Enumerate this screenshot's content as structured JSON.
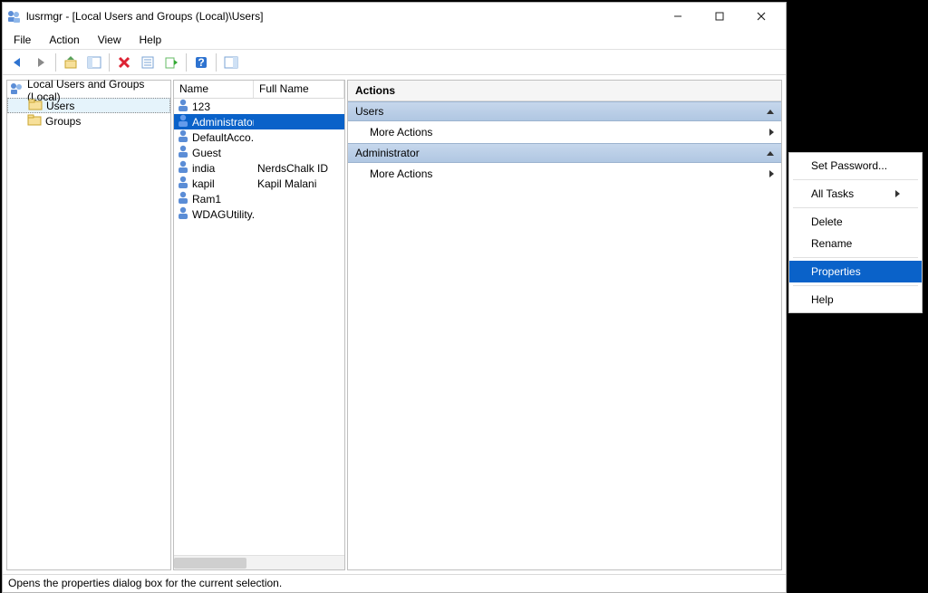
{
  "window": {
    "title": "lusrmgr - [Local Users and Groups (Local)\\Users]"
  },
  "menu": {
    "file": "File",
    "action": "Action",
    "view": "View",
    "help": "Help"
  },
  "tree": {
    "root": "Local Users and Groups (Local)",
    "users": "Users",
    "groups": "Groups"
  },
  "list": {
    "col_name": "Name",
    "col_fullname": "Full Name",
    "rows": [
      {
        "name": "123",
        "full": ""
      },
      {
        "name": "Administrator",
        "full": "",
        "selected": true
      },
      {
        "name": "DefaultAcco...",
        "full": ""
      },
      {
        "name": "Guest",
        "full": ""
      },
      {
        "name": "india",
        "full": "NerdsChalk ID"
      },
      {
        "name": "kapil",
        "full": "Kapil Malani"
      },
      {
        "name": "Ram1",
        "full": ""
      },
      {
        "name": "WDAGUtility...",
        "full": ""
      }
    ]
  },
  "actions": {
    "title": "Actions",
    "section_users": "Users",
    "more_actions": "More Actions",
    "section_admin": "Administrator"
  },
  "contextmenu": {
    "set_password": "Set Password...",
    "all_tasks": "All Tasks",
    "delete": "Delete",
    "rename": "Rename",
    "properties": "Properties",
    "help": "Help"
  },
  "statusbar": {
    "text": "Opens the properties dialog box for the current selection."
  }
}
